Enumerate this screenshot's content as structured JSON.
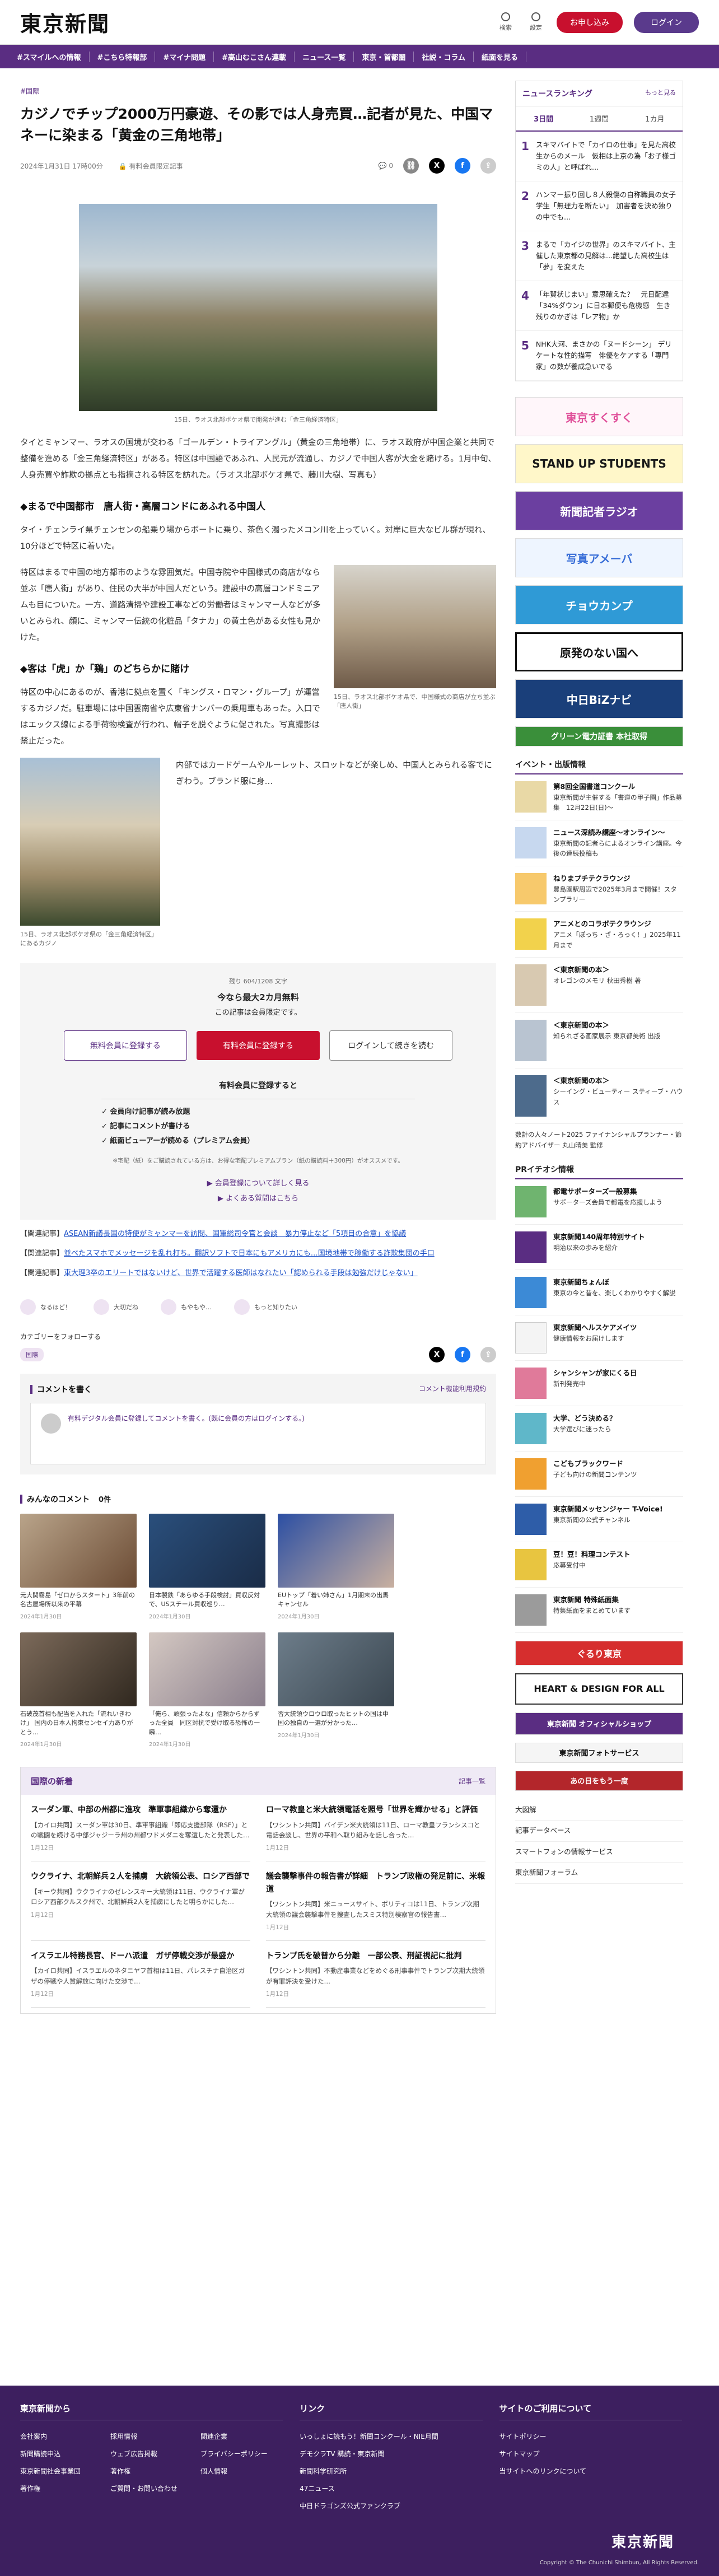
{
  "header": {
    "logo": "東京新聞",
    "search_label": "検索",
    "settings_label": "設定",
    "register_label": "お申し込み",
    "login_label": "ログイン"
  },
  "nav": [
    "#スマイルへの情報",
    "#こちら特報部",
    "#マイナ問題",
    "#高山むこさん連載",
    "ニュース一覧",
    "東京・首都圏",
    "社説・コラム",
    "紙面を見る"
  ],
  "article": {
    "tag": "#国際",
    "title": "カジノでチップ2000万円豪遊、その影では人身売買…記者が見た、中国マネーに染まる「黄金の三角地帯」",
    "date": "2024年1月31日 17時00分",
    "member_badge": "有料会員限定記事",
    "comment_count": "0",
    "caption1": "15日、ラオス北部ボケオ県で開発が進む「金三角経済特区」",
    "p1": "タイとミャンマー、ラオスの国境が交わる「ゴールデン・トライアングル」（黄金の三角地帯）に、ラオス政府が中国企業と共同で整備を進める「金三角経済特区」がある。特区は中国語であふれ、人民元が流通し、カジノで中国人客が大金を賭ける。1月中旬、人身売買や詐欺の拠点とも指摘される特区を訪れた。（ラオス北部ボケオ県で、藤川大樹、写真も）",
    "h_sub1": "◆まるで中国都市　唐人街・高層コンドにあふれる中国人",
    "p2": "タイ・チェンライ県チェンセンの船乗り場からボートに乗り、茶色く濁ったメコン川を上っていく。対岸に巨大なビル群が現れ、10分ほどで特区に着いた。",
    "p3": "特区はまるで中国の地方都市のような雰囲気だ。中国寺院や中国様式の商店がなら並ぶ「唐人街」があり、住民の大半が中国人だという。建設中の高層コンドミニアムも目についた。一方、道路清掃や建設工事などの労働者はミャンマー人などが多いとみられ、顔に、ミャンマー伝統の化粧品「タナカ」の黄土色がある女性も見かけた。",
    "caption2": "15日、ラオス北部ボケオ県で、中国様式の商店が立ち並ぶ「唐人街」",
    "h_sub2": "◆客は「虎」か「鶏」のどちらかに賭け",
    "p4": "特区の中心にあるのが、香港に拠点を置く「キングス・ロマン・グループ」が運営するカジノだ。駐車場には中国雲南省や広東省ナンバーの乗用車もあった。入口ではエックス線による手荷物検査が行われ、帽子を脱ぐように促された。写真撮影は禁止だった。",
    "p5": "内部ではカードゲームやルーレット、スロットなどが楽しめ、中国人とみられる客でにぎわう。ブランド服に身…",
    "caption3": "15日、ラオス北部ボケオ県の「金三角経済特区」にあるカジノ"
  },
  "paywall": {
    "remain": "残り 604/1208 文字",
    "lead1": "今なら最大2カ月無料",
    "lead2": "この記事は会員限定です。",
    "free_btn": "無料会員に登録する",
    "paid_btn": "有料会員に登録する",
    "login_btn": "ログインして続きを読む",
    "benefit_title": "有料会員に登録すると",
    "benefits": [
      "✓ 会員向け記事が読み放題",
      "✓ 記事にコメントが書ける",
      "✓ 紙面ビューアーが読める（プレミアム会員）"
    ],
    "note": "※宅配（紙）をご購読されている方は、お得な宅配プレミアムプラン（紙の購読料＋300円）がオススメです。",
    "link1": "▶ 会員登録について詳しく見る",
    "link2": "▶ よくある質問はこちら"
  },
  "related": [
    {
      "prefix": "【関連記事】",
      "text": "ASEAN新議長国の特使がミャンマーを訪問、国軍総司令官と会談　暴力停止など「5項目の合意」を協議"
    },
    {
      "prefix": "【関連記事】",
      "text": "並べたスマホでメッセージを乱れ打ち。翻訳ソフトで日本にもアメリカにも…国境地帯で稼働する詐欺集団の手口"
    },
    {
      "prefix": "【関連記事】",
      "text": "東大理3卒のエリートではないけど、世界で活躍する医師はなれたい「認められる手段は勉強だけじゃない」"
    }
  ],
  "reactions": [
    "なるほど！",
    "大切だね",
    "もやもや…",
    "もっと知りたい"
  ],
  "follow": {
    "title": "カテゴリーをフォローする",
    "tag": "国際"
  },
  "comment": {
    "title": "コメントを書く",
    "rule": "コメント機能利用規約",
    "placeholder": "有料デジタル会員に登録してコメントを書く。(既に会員の方はログインする。)"
  },
  "comments_head": {
    "title": "みんなのコメント",
    "count": "0件"
  },
  "thumbs": [
    {
      "t": "元大関霧島「ゼロからスタート」3年前の名古屋場所以来の平幕",
      "d": "2024年1月30日"
    },
    {
      "t": "日本製鉄「あらゆる手段検討」買収反対で、USスチール買収巡り…",
      "d": "2024年1月30日"
    },
    {
      "t": "EUトップ「着い姉さん」1月期末の出馬キャンセル",
      "d": "2024年1月30日"
    },
    {
      "t": "石破茂首相も配当を入れた「流れいきわけ」 国内の日本人拘束センセイ力ありがとう…",
      "d": "2024年1月30日"
    },
    {
      "t": "「俺ら、頑張ったよな」信頼からからずった全員　同区対抗で受け取る恐怖の一瞬…",
      "d": "2024年1月30日"
    },
    {
      "t": "習大統領ウロウロ取ったヒットの国は中国の独自の一選が分かった…",
      "d": "2024年1月30日"
    }
  ],
  "kokusai": {
    "title": "国際の新着",
    "more": "記事一覧",
    "items": [
      {
        "t": "スーダン軍、中部の州都に進攻　準軍事組織から奪還か",
        "s": "【カイロ共同】スーダン軍は30日、準軍事組織「即応支援部隊（RSF）」との戦闘を続ける中部ジャジーラ州の州都ワドメダニを奪還したと発表した…",
        "d": "1月12日"
      },
      {
        "t": "ローマ教皇と米大統領電話を照号「世界を輝かせる」と評価",
        "s": "【ワシントン共同】バイデン米大統領は11日、ローマ教皇フランシスコと電話会談し、世界の平和へ取り組みを話し合った…",
        "d": "1月12日"
      },
      {
        "t": "ウクライナ、北朝鮮兵２人を捕虜　大統領公表、ロシア西部で",
        "s": "【キーウ共同】ウクライナのゼレンスキー大統領は11日、ウクライナ軍がロシア西部クルスク州で、北朝鮮兵2人を捕虜にしたと明らかにした…",
        "d": "1月12日"
      },
      {
        "t": "議会襲撃事件の報告書が詳細　トランプ政権の発足前に、米報道",
        "s": "【ワシントン共同】米ニュースサイト、ポリティコは11日、トランプ次期大統領の議会襲撃事件を捜査したスミス特別検察官の報告書…",
        "d": "1月12日"
      },
      {
        "t": "イスラエル特務長官、ドーハ派遣　ガザ停戦交渉が最盛か",
        "s": "【カイロ共同】イスラエルのネタニヤフ首相は11日、パレスチナ自治区ガザの停戦や人質解放に向けた交渉で…",
        "d": "1月12日"
      },
      {
        "t": "トランプ氏を破普から分離　一部公表、刑証視記に批判",
        "s": "【ワシントン共同】不動産事業などをめぐる刑事事件でトランプ次期大統領が有罪評決を受けた…",
        "d": "1月12日"
      }
    ]
  },
  "ranking": {
    "title": "ニュースランキング",
    "more": "もっと見る",
    "tabs": [
      "3日間",
      "1週間",
      "1カ月"
    ],
    "items": [
      "スキマバイトで「カイロの仕事」を見た高校生からのメール　仮相は上京の為「お子様ゴミの人」と呼ばれ…",
      "ハンマー振り回し８人殺傷の自称職員の女子学生「無理力を断たい」　加害者を決め独りの中でも…",
      "まるで「カイジの世界」のスキマバイト、主催した東京都の見解は…絶望した高校生は「夢」を変えた",
      "「年賀状じまい」意思確えた？　元日配達「34%ダウン」に日本郵便も危機感　生き残りのかぎは「レア物」か",
      "NHK大河、まさかの「ヌードシーン」 デリケートな性的描写　俳優をケアする「専門家」の数が養成急いでる"
    ]
  },
  "banners": [
    "東京すくすく",
    "STAND UP STUDENTS",
    "新聞記者ラジオ",
    "写真アメーバ",
    "チョウカンプ",
    "原発のない国へ",
    "中日BiZナビ",
    "グリーン電力証書 本社取得"
  ],
  "events": {
    "title": "イベント・出版情報",
    "items": [
      {
        "b": "第8回全国書道コンクール",
        "t": "東京新聞が主催する「書道の甲子園」作品募集　12月22日(日)〜"
      },
      {
        "b": "ニュース深読み講座〜オンライン〜",
        "t": "東京新聞の記者らによるオンライン講座。今後の連続投稿も"
      },
      {
        "b": "ねりまプチテクラウンジ",
        "t": "豊島園駅周辺で2025年3月まで開催！スタンプラリー"
      },
      {
        "b": "アニメとのコラボテクラウンジ",
        "t": "アニメ「ぽっち・ざ・ろっく！」2025年11月まで"
      },
      {
        "b": "＜東京新聞の本＞",
        "t": "オレゴンのメモリ 秋田秀樹 著"
      },
      {
        "b": "＜東京新聞の本＞",
        "t": "知られざる画家展示 東京都美術 出版"
      },
      {
        "b": "＜東京新聞の本＞",
        "t": "シーイング・ビューティー スティーブ・ハウス"
      }
    ],
    "note": "数計の人々ノート2025 ファイナンシャルプランナー・節約アドバイザー 丸山晴美 監修"
  },
  "pr": {
    "title": "PRイチオシ情報",
    "items": [
      {
        "b": "都電サポーターズ一般募集",
        "t": "サポーターズ会員で都電を応援しよう"
      },
      {
        "b": "東京新聞140周年特別サイト",
        "t": "明治以来の歩みを紹介"
      },
      {
        "b": "東京新聞ちょんぼ",
        "t": "東京の今と昔を、楽しくわかりやすく解説"
      },
      {
        "b": "東京新聞ヘルスケアメイツ",
        "t": "健康情報をお届けします"
      },
      {
        "b": "シャンシャンが家にくる日",
        "t": "新刊発売中"
      },
      {
        "b": "大学、どう決める？",
        "t": "大学選びに迷ったら"
      },
      {
        "b": "こどもプラックワード",
        "t": "子ども向けの新聞コンテンツ"
      },
      {
        "b": "東京新聞メッセンジャー T-Voice!",
        "t": "東京新聞の公式チャンネル"
      },
      {
        "b": "豆！豆！料理コンテスト",
        "t": "応募受付中"
      },
      {
        "b": "東京新聞 特殊紙面集",
        "t": "特集紙面をまとめています"
      }
    ]
  },
  "side_links": [
    "大図解",
    "記事データベース",
    "スマートフォンの情報サービス",
    "東京新聞フォーラム"
  ],
  "footer": {
    "col1": {
      "title": "東京新聞から",
      "links": [
        "会社案内",
        "採用情報",
        "関連企業",
        "新聞購読申込",
        "ウェブ広告掲載",
        "プライバシーポリシー",
        "東京新聞社会事業団",
        "著作権",
        "個人情報",
        "著作権",
        "ご質問・お問い合わせ",
        ""
      ]
    },
    "col2": {
      "title": "リンク",
      "links": [
        "いっしょに読もう！新聞コンクール・NIE月間",
        "デモクラTV 購読・東京新聞",
        "新聞科学研究所",
        "47ニュース",
        "中日ドラゴンズ公式ファンクラブ"
      ]
    },
    "col3": {
      "title": "サイトのご利用について",
      "links": [
        "サイトポリシー",
        "サイトマップ",
        "当サイトへのリンクについて"
      ]
    },
    "logo": "東京新聞",
    "copyright": "Copyright © The Chunichi Shimbun, All Rights Reserved."
  },
  "colors": {
    "brand": "#5a2d82",
    "accent": "#c8102e"
  }
}
